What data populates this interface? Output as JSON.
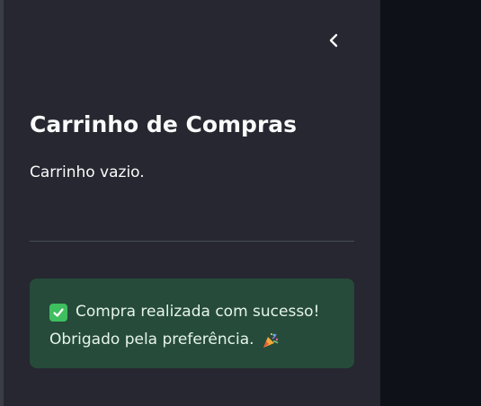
{
  "sidebar": {
    "title": "Carrinho de Compras",
    "empty_message": "Carrinho vazio.",
    "success": {
      "line1": "Compra realizada com sucesso!",
      "line2": "Obrigado pela preferência."
    },
    "icons": {
      "collapse": "chevron-left-icon",
      "check": "check-mark-icon",
      "party": "party-popper-icon"
    }
  },
  "colors": {
    "sidebar_bg": "#262730",
    "main_bg": "#0e1117",
    "success_bg": "#264b3a",
    "text": "#fafafa"
  }
}
